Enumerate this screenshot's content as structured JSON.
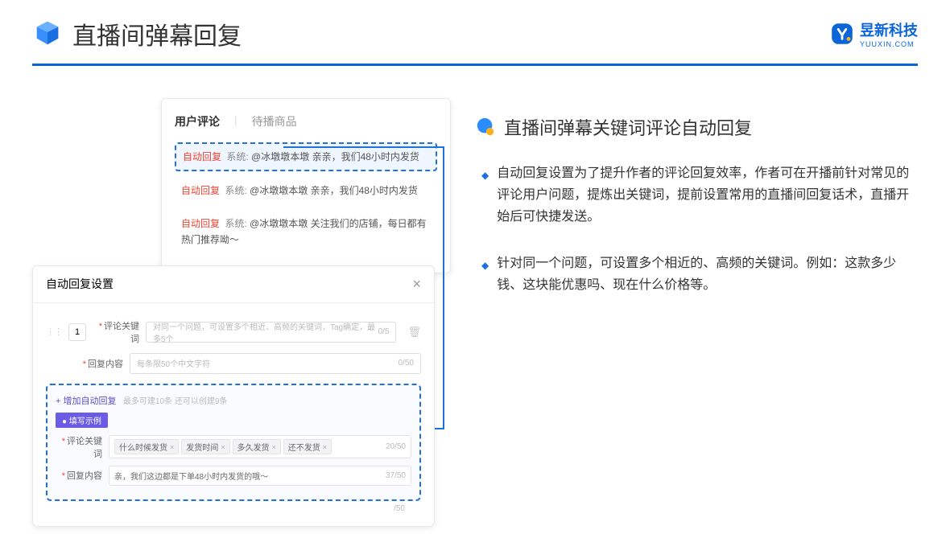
{
  "header": {
    "title": "直播间弹幕回复",
    "brand_cn": "昱新科技",
    "brand_en": "YUUXIN.COM"
  },
  "card1": {
    "tab1": "用户评论",
    "tab2": "待播商品",
    "auto_label": "自动回复",
    "sys_label": "系统:",
    "c1_text": "@冰墩墩本墩 亲亲，我们48小时内发货",
    "c2_text": "@冰墩墩本墩 亲亲，我们48小时内发货",
    "c3_text": "@冰墩墩本墩 关注我们的店铺，每日都有热门推荐呦～"
  },
  "card2": {
    "title": "自动回复设置",
    "num": "1",
    "label_kw": "评论关键词",
    "label_content": "回复内容",
    "kw_placeholder": "对同一个问题，可设置多个相近、高频的关键词，Tag确定，最多5个",
    "kw_count": "0/5",
    "content_placeholder": "每条限50个中文字符",
    "content_count": "0/50",
    "add_link": "+ 增加自动回复",
    "add_hint": "最多可建10条 还可以创建9条",
    "ex_badge": "● 填写示例",
    "ex_kw_tags": [
      "什么时候发货",
      "发货时间",
      "多久发货",
      "还不发货"
    ],
    "ex_kw_count": "20/50",
    "ex_content": "亲，我们这边都是下单48小时内发货的哦～",
    "ex_content_count": "37/50",
    "trash_count": "/50"
  },
  "right": {
    "title": "直播间弹幕关键词评论自动回复",
    "b1": "自动回复设置为了提升作者的评论回复效率，作者可在开播前针对常见的评论用户问题，提炼出关键词，提前设置常用的直播间回复话术，直播开始后可快捷发送。",
    "b2": "针对同一个问题，可设置多个相近的、高频的关键词。例如：这款多少钱、这块能优惠吗、现在什么价格等。"
  }
}
